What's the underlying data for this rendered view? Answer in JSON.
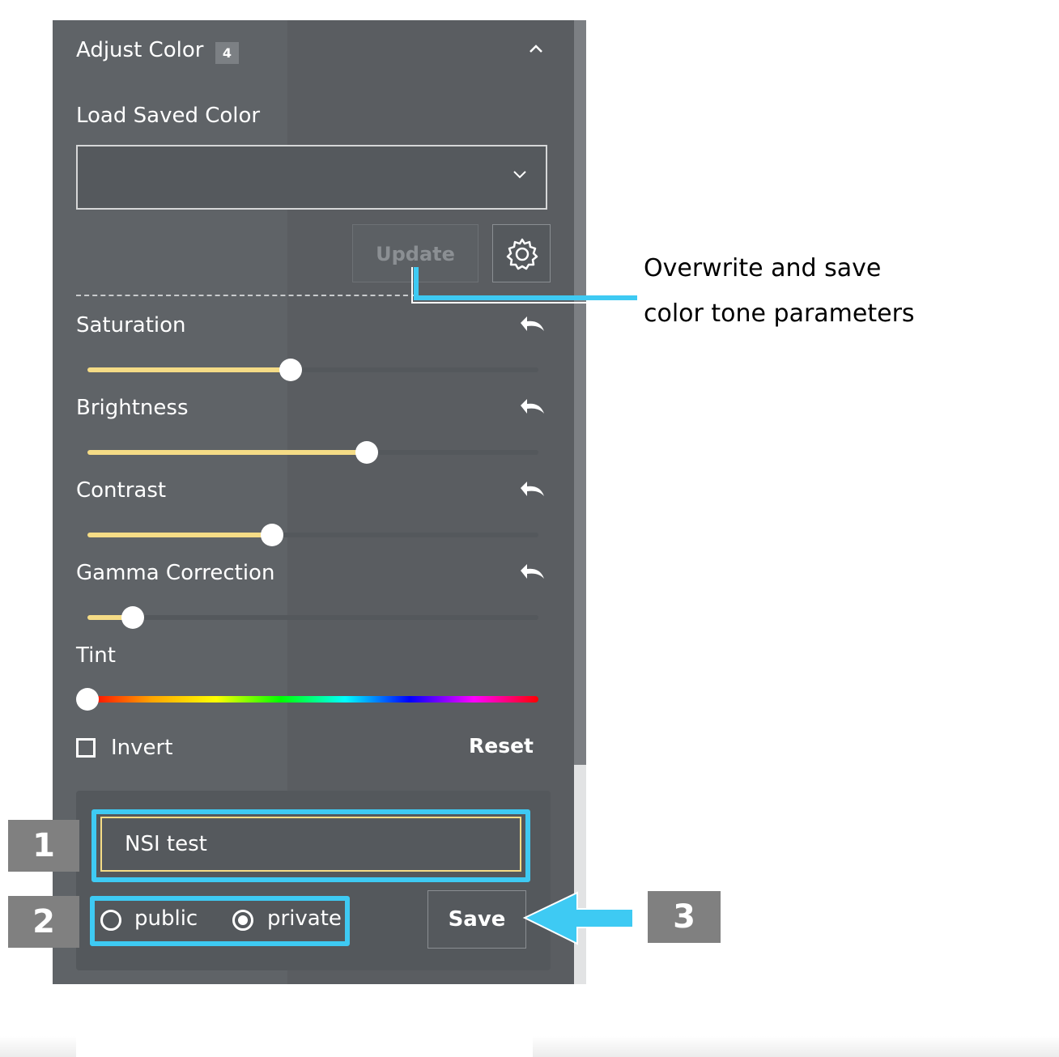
{
  "panel": {
    "title": "Adjust Color",
    "badge_count": "4",
    "collapse_icon": "chevron-up-icon",
    "load_label": "Load Saved Color",
    "dropdown_value": "",
    "update_label": "Update",
    "settings_icon": "gear-icon"
  },
  "sliders": [
    {
      "label": "Saturation",
      "value": 0.45,
      "reset_icon": "undo-icon"
    },
    {
      "label": "Brightness",
      "value": 0.62,
      "reset_icon": "undo-icon"
    },
    {
      "label": "Contrast",
      "value": 0.41,
      "reset_icon": "undo-icon"
    },
    {
      "label": "Gamma Correction",
      "value": 0.1,
      "reset_icon": "undo-icon"
    }
  ],
  "tint": {
    "label": "Tint",
    "value": 0.0
  },
  "invert": {
    "label": "Invert",
    "checked": false
  },
  "reset_label": "Reset",
  "save_form": {
    "name_value": "NSI test",
    "radio_public": "public",
    "radio_private": "private",
    "selected": "private",
    "save_label": "Save"
  },
  "annotations": {
    "note_line1": "Overwrite and save",
    "note_line2": "color tone parameters",
    "badge1": "1",
    "badge2": "2",
    "badge3": "3",
    "highlight_color": "#3ecaf3",
    "badge_color": "#808080"
  },
  "colors": {
    "panel_bg": "#5f6367",
    "slider_fill": "#f5dc86",
    "text": "#ffffff"
  }
}
